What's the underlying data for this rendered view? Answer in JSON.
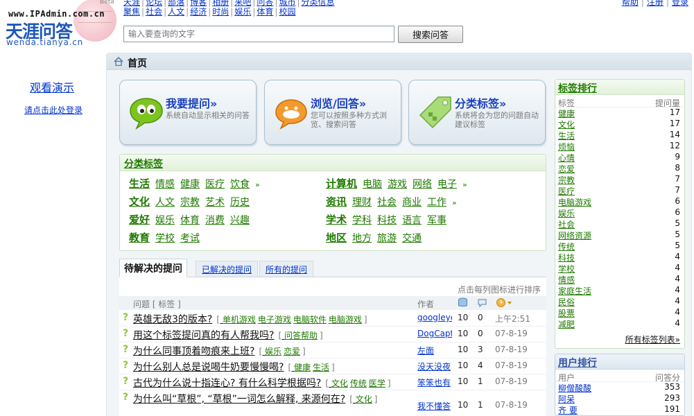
{
  "header": {
    "watermark": "www.IPAdmin.com.cn",
    "brand": "天涯问答",
    "domain": "wenda.tianya.cn",
    "beta": "Beta",
    "nav_row1": [
      "天涯",
      "论坛",
      "部落",
      "博客",
      "相册",
      "来吧",
      "问答",
      "城市",
      "分类信息"
    ],
    "nav_row2": [
      "聚焦",
      "社会",
      "人文",
      "经济",
      "时尚",
      "娱乐",
      "体育",
      "校园"
    ],
    "top_links": [
      "帮助",
      "注册",
      "登录"
    ]
  },
  "search": {
    "placeholder": "输入要查询的文字",
    "button_label": "搜索问答"
  },
  "left": {
    "demo": "观看演示",
    "login": "请点击此处登录"
  },
  "breadcrumb": {
    "current": "首页"
  },
  "actions": [
    {
      "title": "我要提问»",
      "desc": "系统自动显示相关的问答"
    },
    {
      "title": "浏览/回答»",
      "desc": "您可以按照多种方式浏览、搜索问答"
    },
    {
      "title": "分类标签»",
      "desc": "系统将会为您的问题自动建议标签"
    }
  ],
  "categories": {
    "title": "分类标签",
    "groups": [
      {
        "main": "生活",
        "subs": [
          "情感",
          "健康",
          "医疗",
          "饮食"
        ],
        "more": "»"
      },
      {
        "main": "计算机",
        "subs": [
          "电脑",
          "游戏",
          "网络",
          "电子"
        ],
        "more": "»"
      },
      {
        "main": "文化",
        "subs": [
          "人文",
          "宗教",
          "艺术",
          "历史"
        ],
        "more": ""
      },
      {
        "main": "资讯",
        "subs": [
          "理财",
          "社会",
          "商业",
          "工作"
        ],
        "more": "»"
      },
      {
        "main": "爱好",
        "subs": [
          "娱乐",
          "体育",
          "消费",
          "兴趣"
        ],
        "more": ""
      },
      {
        "main": "学术",
        "subs": [
          "学科",
          "科技",
          "语言",
          "军事"
        ],
        "more": ""
      },
      {
        "main": "教育",
        "subs": [
          "学校",
          "考试"
        ],
        "more": ""
      },
      {
        "main": "地区",
        "subs": [
          "地方",
          "旅游",
          "交通"
        ],
        "more": ""
      }
    ]
  },
  "tabs": [
    "待解决的提问",
    "已解决的提问",
    "所有的提问"
  ],
  "questions": {
    "sort_hint": "点击每列图标进行排序",
    "col_question": "问题 [ 标签 ]",
    "col_author": "作者",
    "rows": [
      {
        "title": "英雄无敌3的版本?",
        "tags": [
          "单机游戏",
          "电子游戏",
          "电脑软件",
          "电脑游戏"
        ],
        "author": "googleye",
        "n1": "10",
        "n2": "0",
        "time": "上午2:51"
      },
      {
        "title": "用这个标签提问真的有人帮我吗?",
        "tags": [
          "问答帮助"
        ],
        "author": "DogCapt",
        "n1": "10",
        "n2": "0",
        "time": "07-8-19"
      },
      {
        "title": "为什么同事顶着吻痕来上班?",
        "tags": [
          "娱乐",
          "恋爱"
        ],
        "author": "左面",
        "n1": "10",
        "n2": "3",
        "time": "07-8-19"
      },
      {
        "title": "为什么别人总是说喝牛奶要慢慢喝?",
        "tags": [
          "健康",
          "生活"
        ],
        "author": "没天没夜",
        "n1": "10",
        "n2": "4",
        "time": "07-8-19"
      },
      {
        "title": "古代为什么说十指连心? 有什么科学根据吗?",
        "tags": [
          "文化",
          "传统",
          "医学"
        ],
        "author": "笨笨也有",
        "n1": "10",
        "n2": "1",
        "time": "07-8-19"
      },
      {
        "title": "为什么叫“草根”, “草根”一词怎么解释, 来源何在?",
        "tags": [
          "文化"
        ],
        "author": "我不懂答",
        "n1": "10",
        "n2": "1",
        "time": "07-8-19"
      }
    ]
  },
  "tag_rank": {
    "title": "标签排行",
    "col_name": "标签",
    "col_count": "提问量",
    "rows": [
      {
        "name": "健康",
        "count": "17"
      },
      {
        "name": "文化",
        "count": "17"
      },
      {
        "name": "生活",
        "count": "14"
      },
      {
        "name": "烦恼",
        "count": "12"
      },
      {
        "name": "心情",
        "count": "9"
      },
      {
        "name": "恋爱",
        "count": "8"
      },
      {
        "name": "宗教",
        "count": "7"
      },
      {
        "name": "医疗",
        "count": "7"
      },
      {
        "name": "电脑游戏",
        "count": "6"
      },
      {
        "name": "娱乐",
        "count": "6"
      },
      {
        "name": "社会",
        "count": "5"
      },
      {
        "name": "网络资源",
        "count": "5"
      },
      {
        "name": "传统",
        "count": "5"
      },
      {
        "name": "科技",
        "count": "4"
      },
      {
        "name": "学校",
        "count": "4"
      },
      {
        "name": "情感",
        "count": "4"
      },
      {
        "name": "家庭生活",
        "count": "4"
      },
      {
        "name": "民俗",
        "count": "4"
      },
      {
        "name": "股票",
        "count": "4"
      },
      {
        "name": "减肥",
        "count": "4"
      }
    ],
    "all_link": "所有标签列表»"
  },
  "user_rank": {
    "title": "用户排行",
    "col_name": "用户",
    "col_count": "问答分",
    "rows": [
      {
        "name": "柳僧酸酸",
        "count": "353"
      },
      {
        "name": "阿呆",
        "count": "293"
      },
      {
        "name": "齐 要",
        "count": "191"
      }
    ]
  },
  "icons": {
    "home": "home-icon",
    "ask": "speech-bubble-green-icon",
    "browse": "speech-bubble-orange-icon",
    "tag": "price-tag-icon",
    "sort1": "database-icon",
    "sort2": "comment-icon",
    "sort3": "clock-icon"
  }
}
